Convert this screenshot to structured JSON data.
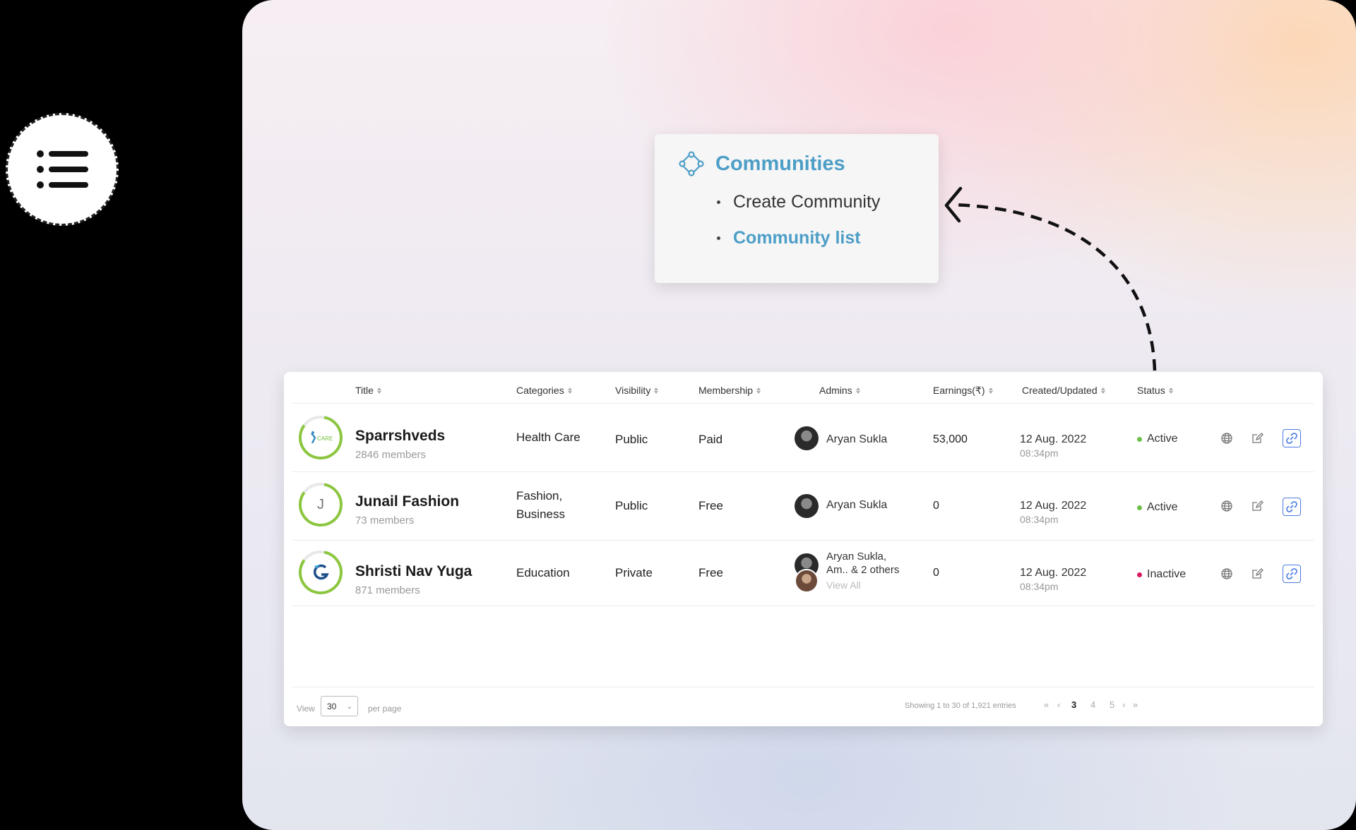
{
  "menu": {
    "title": "Communities",
    "items": [
      {
        "label": "Create Community",
        "active": false
      },
      {
        "label": "Community list",
        "active": true
      }
    ],
    "accent": "#4d9ec6"
  },
  "table": {
    "columns": [
      "Title",
      "Categories",
      "Visibility",
      "Membership",
      "Admins",
      "Earnings(₹)",
      "Created/Updated",
      "Status"
    ],
    "rows": [
      {
        "title": "Sparrshveds",
        "members": "2846 members",
        "category": "Health Care",
        "visibility": "Public",
        "membership": "Paid",
        "admins": "Aryan Sukla",
        "earnings": "53,000",
        "date": "12 Aug. 2022",
        "time": "08:34pm",
        "status": "Active"
      },
      {
        "title": "Junail Fashion",
        "members": "73 members",
        "initial": "J",
        "category_l1": "Fashion,",
        "category_l2": "Business",
        "visibility": "Public",
        "membership": "Free",
        "admins": "Aryan Sukla",
        "earnings": "0",
        "date": "12 Aug. 2022",
        "time": "08:34pm",
        "status": "Active"
      },
      {
        "title": "Shristi Nav Yuga",
        "members": "871 members",
        "category": "Education",
        "visibility": "Private",
        "membership": "Free",
        "admins_l1": "Aryan Sukla,",
        "admins_l2": "Am.. & 2 others",
        "view_all": "View All",
        "earnings": "0",
        "date": "12 Aug. 2022",
        "time": "08:34pm",
        "status": "Inactive"
      }
    ],
    "status_colors": {
      "active": "#6cc04a",
      "inactive": "#d81b60"
    }
  },
  "footer": {
    "view_label": "View",
    "per_page_value": "30",
    "per_page_label": "per page",
    "showing": "Showing 1 to 30 of 1,921 entries",
    "pages": [
      "3",
      "4",
      "5"
    ],
    "current_page": "3"
  }
}
